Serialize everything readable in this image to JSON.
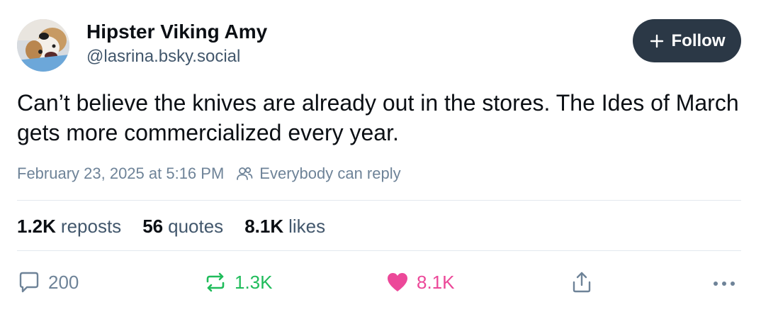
{
  "author": {
    "display_name": "Hipster Viking Amy",
    "handle": "@lasrina.bsky.social",
    "avatar_icon": "dog-avatar"
  },
  "follow_button": {
    "label": "Follow",
    "icon": "plus-icon"
  },
  "post": {
    "text": "Can’t believe the knives are already out in the stores. The Ides of March gets more commercialized every year.",
    "timestamp": "February 23, 2025 at 5:16 PM",
    "reply_setting": "Everybody can reply"
  },
  "stats": [
    {
      "count": "1.2K",
      "label": "reposts"
    },
    {
      "count": "56",
      "label": "quotes"
    },
    {
      "count": "8.1K",
      "label": "likes"
    }
  ],
  "actions": {
    "reply_count": "200",
    "repost_count": "1.3K",
    "like_count": "8.1K"
  },
  "colors": {
    "follow_bg": "#2b3846",
    "repost_active": "#20bc5b",
    "like_active": "#ec4899",
    "muted_text": "#6e8398"
  }
}
